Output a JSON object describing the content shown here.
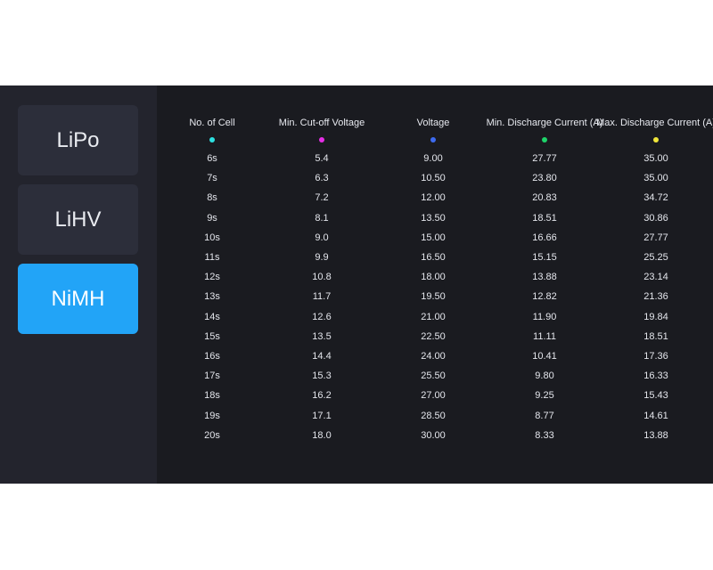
{
  "tabs": [
    {
      "label": "LiPo",
      "active": false
    },
    {
      "label": "LiHV",
      "active": false
    },
    {
      "label": "NiMH",
      "active": true
    }
  ],
  "columns": [
    {
      "header": "No. of Cell",
      "dot_color": "#2de0e0"
    },
    {
      "header": "Min. Cut-off Voltage",
      "dot_color": "#e62ee6"
    },
    {
      "header": "Voltage",
      "dot_color": "#3d6bf0"
    },
    {
      "header": "Min. Discharge Current (A)",
      "dot_color": "#1ed46a"
    },
    {
      "header": "Max. Discharge Current (A)",
      "dot_color": "#f0e63a"
    }
  ],
  "rows": [
    [
      "6s",
      "5.4",
      "9.00",
      "27.77",
      "35.00"
    ],
    [
      "7s",
      "6.3",
      "10.50",
      "23.80",
      "35.00"
    ],
    [
      "8s",
      "7.2",
      "12.00",
      "20.83",
      "34.72"
    ],
    [
      "9s",
      "8.1",
      "13.50",
      "18.51",
      "30.86"
    ],
    [
      "10s",
      "9.0",
      "15.00",
      "16.66",
      "27.77"
    ],
    [
      "11s",
      "9.9",
      "16.50",
      "15.15",
      "25.25"
    ],
    [
      "12s",
      "10.8",
      "18.00",
      "13.88",
      "23.14"
    ],
    [
      "13s",
      "11.7",
      "19.50",
      "12.82",
      "21.36"
    ],
    [
      "14s",
      "12.6",
      "21.00",
      "11.90",
      "19.84"
    ],
    [
      "15s",
      "13.5",
      "22.50",
      "11.11",
      "18.51"
    ],
    [
      "16s",
      "14.4",
      "24.00",
      "10.41",
      "17.36"
    ],
    [
      "17s",
      "15.3",
      "25.50",
      "9.80",
      "16.33"
    ],
    [
      "18s",
      "16.2",
      "27.00",
      "9.25",
      "15.43"
    ],
    [
      "19s",
      "17.1",
      "28.50",
      "8.77",
      "14.61"
    ],
    [
      "20s",
      "18.0",
      "30.00",
      "8.33",
      "13.88"
    ]
  ]
}
